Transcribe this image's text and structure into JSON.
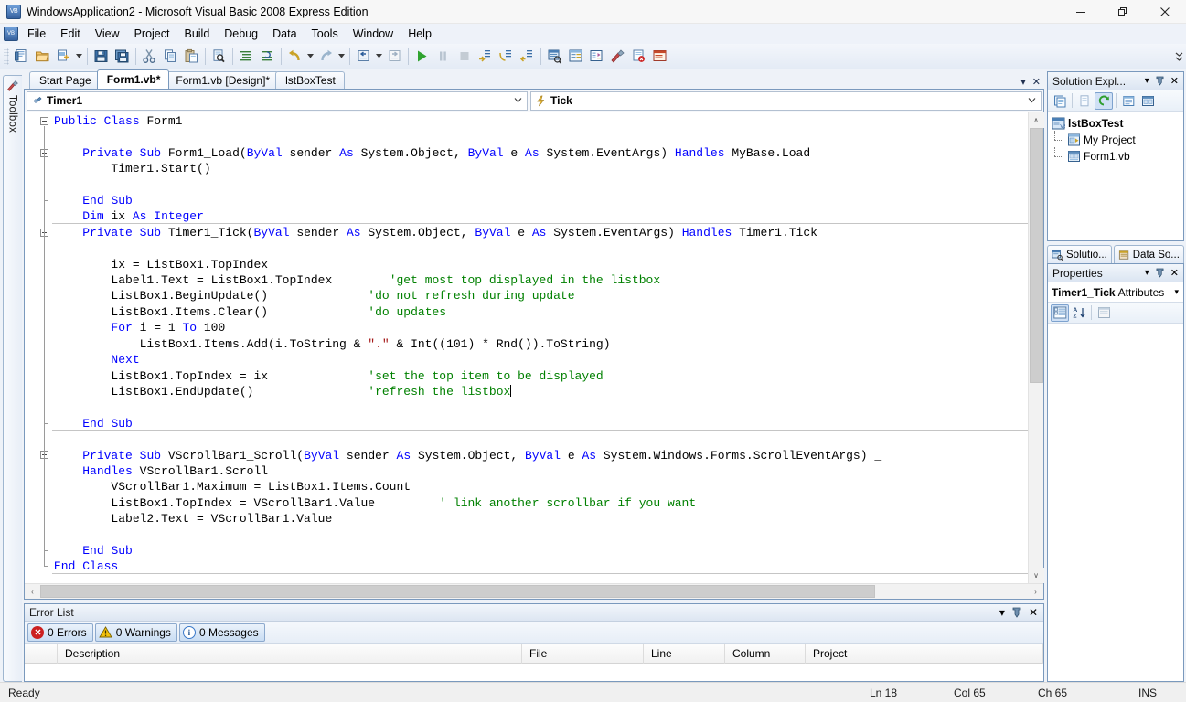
{
  "window": {
    "title": "WindowsApplication2 - Microsoft Visual Basic 2008 Express Edition",
    "app_icon": "visual-basic-icon",
    "minimize": "—",
    "maximize": "❐",
    "close": "✕"
  },
  "menu": {
    "items": [
      "File",
      "Edit",
      "View",
      "Project",
      "Build",
      "Debug",
      "Data",
      "Tools",
      "Window",
      "Help"
    ]
  },
  "toolbar": {
    "buttons": [
      {
        "name": "new-project-icon",
        "title": "New Project"
      },
      {
        "name": "open-file-icon",
        "title": "Open File"
      },
      {
        "name": "add-new-item-icon",
        "title": "Add New Item"
      },
      {
        "name": "save-icon",
        "title": "Save"
      },
      {
        "name": "save-all-icon",
        "title": "Save All"
      },
      {
        "name": "cut-icon",
        "title": "Cut"
      },
      {
        "name": "copy-icon",
        "title": "Copy"
      },
      {
        "name": "paste-icon",
        "title": "Paste"
      },
      {
        "name": "find-icon",
        "title": "Find"
      },
      {
        "name": "comment-icon",
        "title": "Comment"
      },
      {
        "name": "uncomment-icon",
        "title": "Uncomment"
      },
      {
        "name": "undo-icon",
        "title": "Undo"
      },
      {
        "name": "redo-icon",
        "title": "Redo"
      },
      {
        "name": "navigate-backward-icon",
        "title": "Navigate Backward"
      },
      {
        "name": "navigate-forward-icon",
        "title": "Navigate Forward"
      },
      {
        "name": "start-debugging-icon",
        "title": "Start Debugging"
      },
      {
        "name": "break-all-icon",
        "title": "Break All"
      },
      {
        "name": "stop-debugging-icon",
        "title": "Stop Debugging"
      },
      {
        "name": "step-into-icon",
        "title": "Step Into"
      },
      {
        "name": "step-over-icon",
        "title": "Step Over"
      },
      {
        "name": "step-out-icon",
        "title": "Step Out"
      },
      {
        "name": "solution-explorer-icon",
        "title": "Solution Explorer"
      },
      {
        "name": "properties-window-icon",
        "title": "Properties Window"
      },
      {
        "name": "object-browser-icon",
        "title": "Object Browser"
      },
      {
        "name": "toolbox-icon",
        "title": "Toolbox"
      },
      {
        "name": "error-list-icon",
        "title": "Error List"
      },
      {
        "name": "command-window-icon",
        "title": "Command Window"
      }
    ],
    "overflow_label": "»"
  },
  "toolbox_strip": {
    "label": "Toolbox",
    "icon": "toolbox-icon"
  },
  "document_tabs": [
    {
      "label": "Start Page",
      "active": false
    },
    {
      "label": "Form1.vb*",
      "active": true
    },
    {
      "label": "Form1.vb [Design]*",
      "active": false
    },
    {
      "label": "lstBoxTest",
      "active": false
    }
  ],
  "doc_tab_controls": {
    "dropdown": "▾",
    "close": "✕"
  },
  "editor": {
    "class_combo": {
      "value": "Timer1",
      "icon": "class-object-icon",
      "arrow": "⌄"
    },
    "member_combo": {
      "value": "Tick",
      "icon": "event-lightning-icon",
      "arrow": "⌄"
    },
    "code_lines": [
      {
        "n": 1,
        "indent": 0,
        "tokens": [
          [
            "kw",
            "Public"
          ],
          [
            "sp",
            " "
          ],
          [
            "kw",
            "Class"
          ],
          [
            "sp",
            " "
          ],
          [
            "id",
            "Form1"
          ]
        ]
      },
      {
        "n": 2,
        "indent": 0,
        "tokens": []
      },
      {
        "n": 3,
        "indent": 1,
        "tokens": [
          [
            "kw",
            "Private"
          ],
          [
            "sp",
            " "
          ],
          [
            "kw",
            "Sub"
          ],
          [
            "sp",
            " "
          ],
          [
            "id",
            "Form1_Load("
          ],
          [
            "kw",
            "ByVal"
          ],
          [
            "sp",
            " "
          ],
          [
            "id",
            "sender"
          ],
          [
            "sp",
            " "
          ],
          [
            "kw",
            "As"
          ],
          [
            "sp",
            " "
          ],
          [
            "id",
            "System.Object, "
          ],
          [
            "kw",
            "ByVal"
          ],
          [
            "sp",
            " "
          ],
          [
            "id",
            "e"
          ],
          [
            "sp",
            " "
          ],
          [
            "kw",
            "As"
          ],
          [
            "sp",
            " "
          ],
          [
            "id",
            "System.EventArgs) "
          ],
          [
            "kw",
            "Handles"
          ],
          [
            "sp",
            " "
          ],
          [
            "id",
            "MyBase.Load"
          ]
        ]
      },
      {
        "n": 4,
        "indent": 2,
        "tokens": [
          [
            "id",
            "Timer1.Start()"
          ]
        ]
      },
      {
        "n": 5,
        "indent": 0,
        "tokens": []
      },
      {
        "n": 6,
        "indent": 1,
        "tokens": [
          [
            "kw",
            "End"
          ],
          [
            "sp",
            " "
          ],
          [
            "kw",
            "Sub"
          ]
        ]
      },
      {
        "n": 7,
        "indent": 1,
        "tokens": [
          [
            "kw",
            "Dim"
          ],
          [
            "sp",
            " "
          ],
          [
            "id",
            "ix"
          ],
          [
            "sp",
            " "
          ],
          [
            "kw",
            "As"
          ],
          [
            "sp",
            " "
          ],
          [
            "kw",
            "Integer"
          ]
        ]
      },
      {
        "n": 8,
        "indent": 1,
        "tokens": [
          [
            "kw",
            "Private"
          ],
          [
            "sp",
            " "
          ],
          [
            "kw",
            "Sub"
          ],
          [
            "sp",
            " "
          ],
          [
            "id",
            "Timer1_Tick("
          ],
          [
            "kw",
            "ByVal"
          ],
          [
            "sp",
            " "
          ],
          [
            "id",
            "sender"
          ],
          [
            "sp",
            " "
          ],
          [
            "kw",
            "As"
          ],
          [
            "sp",
            " "
          ],
          [
            "id",
            "System.Object, "
          ],
          [
            "kw",
            "ByVal"
          ],
          [
            "sp",
            " "
          ],
          [
            "id",
            "e"
          ],
          [
            "sp",
            " "
          ],
          [
            "kw",
            "As"
          ],
          [
            "sp",
            " "
          ],
          [
            "id",
            "System.EventArgs) "
          ],
          [
            "kw",
            "Handles"
          ],
          [
            "sp",
            " "
          ],
          [
            "id",
            "Timer1.Tick"
          ]
        ]
      },
      {
        "n": 9,
        "indent": 0,
        "tokens": []
      },
      {
        "n": 10,
        "indent": 2,
        "tokens": [
          [
            "id",
            "ix = ListBox1.TopIndex"
          ]
        ]
      },
      {
        "n": 11,
        "indent": 2,
        "tokens": [
          [
            "id",
            "Label1.Text = ListBox1.TopIndex"
          ],
          [
            "pad",
            "        "
          ],
          [
            "cm",
            "'get most top displayed in the listbox"
          ]
        ]
      },
      {
        "n": 12,
        "indent": 2,
        "tokens": [
          [
            "id",
            "ListBox1.BeginUpdate()"
          ],
          [
            "pad",
            "              "
          ],
          [
            "cm",
            "'do not refresh during update"
          ]
        ]
      },
      {
        "n": 13,
        "indent": 2,
        "tokens": [
          [
            "id",
            "ListBox1.Items.Clear()"
          ],
          [
            "pad",
            "              "
          ],
          [
            "cm",
            "'do updates"
          ]
        ]
      },
      {
        "n": 14,
        "indent": 2,
        "tokens": [
          [
            "kw",
            "For"
          ],
          [
            "sp",
            " "
          ],
          [
            "id",
            "i = 1 "
          ],
          [
            "kw",
            "To"
          ],
          [
            "sp",
            " "
          ],
          [
            "id",
            "100"
          ]
        ]
      },
      {
        "n": 15,
        "indent": 3,
        "tokens": [
          [
            "id",
            "ListBox1.Items.Add(i.ToString & "
          ],
          [
            "st",
            "\".\""
          ],
          [
            "id",
            " & Int((101) * Rnd()).ToString)"
          ]
        ]
      },
      {
        "n": 16,
        "indent": 2,
        "tokens": [
          [
            "kw",
            "Next"
          ]
        ]
      },
      {
        "n": 17,
        "indent": 2,
        "tokens": [
          [
            "id",
            "ListBox1.TopIndex = ix"
          ],
          [
            "pad",
            "              "
          ],
          [
            "cm",
            "'set the top item to be displayed"
          ]
        ]
      },
      {
        "n": 18,
        "indent": 2,
        "tokens": [
          [
            "id",
            "ListBox1.EndUpdate()"
          ],
          [
            "pad",
            "                "
          ],
          [
            "cm",
            "'refresh the listbox"
          ],
          [
            "caret",
            ""
          ]
        ]
      },
      {
        "n": 19,
        "indent": 0,
        "tokens": []
      },
      {
        "n": 20,
        "indent": 1,
        "tokens": [
          [
            "kw",
            "End"
          ],
          [
            "sp",
            " "
          ],
          [
            "kw",
            "Sub"
          ]
        ]
      },
      {
        "n": 21,
        "indent": 0,
        "tokens": []
      },
      {
        "n": 22,
        "indent": 1,
        "tokens": [
          [
            "kw",
            "Private"
          ],
          [
            "sp",
            " "
          ],
          [
            "kw",
            "Sub"
          ],
          [
            "sp",
            " "
          ],
          [
            "id",
            "VScrollBar1_Scroll("
          ],
          [
            "kw",
            "ByVal"
          ],
          [
            "sp",
            " "
          ],
          [
            "id",
            "sender"
          ],
          [
            "sp",
            " "
          ],
          [
            "kw",
            "As"
          ],
          [
            "sp",
            " "
          ],
          [
            "id",
            "System.Object, "
          ],
          [
            "kw",
            "ByVal"
          ],
          [
            "sp",
            " "
          ],
          [
            "id",
            "e"
          ],
          [
            "sp",
            " "
          ],
          [
            "kw",
            "As"
          ],
          [
            "sp",
            " "
          ],
          [
            "id",
            "System.Windows.Forms.ScrollEventArgs) _"
          ]
        ]
      },
      {
        "n": 23,
        "indent": 1,
        "tokens": [
          [
            "kw",
            "Handles"
          ],
          [
            "sp",
            " "
          ],
          [
            "id",
            "VScrollBar1.Scroll"
          ]
        ]
      },
      {
        "n": 24,
        "indent": 2,
        "tokens": [
          [
            "id",
            "VScrollBar1.Maximum = ListBox1.Items.Count"
          ]
        ]
      },
      {
        "n": 25,
        "indent": 2,
        "tokens": [
          [
            "id",
            "ListBox1.TopIndex = VScrollBar1.Value"
          ],
          [
            "pad",
            "         "
          ],
          [
            "cm",
            "' link another scrollbar if you want"
          ]
        ]
      },
      {
        "n": 26,
        "indent": 2,
        "tokens": [
          [
            "id",
            "Label2.Text = VScrollBar1.Value"
          ]
        ]
      },
      {
        "n": 27,
        "indent": 0,
        "tokens": []
      },
      {
        "n": 28,
        "indent": 1,
        "tokens": [
          [
            "kw",
            "End"
          ],
          [
            "sp",
            " "
          ],
          [
            "kw",
            "Sub"
          ]
        ]
      },
      {
        "n": 29,
        "indent": 0,
        "tokens": [
          [
            "kw",
            "End"
          ],
          [
            "sp",
            " "
          ],
          [
            "kw",
            "Class"
          ]
        ]
      }
    ],
    "scroll_up": "∧",
    "scroll_down": "∨",
    "scroll_left": "‹",
    "scroll_right": "›"
  },
  "error_list": {
    "title": "Error List",
    "dropdown": "▾",
    "pin": "pin-icon",
    "close": "✕",
    "toggles": [
      {
        "label": "0 Errors",
        "icon": "error-icon",
        "color": "#cc2020"
      },
      {
        "label": "0 Warnings",
        "icon": "warning-icon",
        "color": "#f2c20c"
      },
      {
        "label": "0 Messages",
        "icon": "info-icon",
        "color": "#3a78c8"
      }
    ],
    "columns": [
      "Description",
      "File",
      "Line",
      "Column",
      "Project"
    ],
    "rows": []
  },
  "solution_explorer": {
    "title": "Solution Expl...",
    "dropdown": "▾",
    "pin": "pin-icon",
    "close": "✕",
    "tools": [
      {
        "name": "properties-icon"
      },
      {
        "name": "show-all-files-icon"
      },
      {
        "name": "refresh-icon"
      },
      {
        "name": "view-code-icon"
      },
      {
        "name": "view-designer-icon"
      }
    ],
    "tree": [
      {
        "label": "lstBoxTest",
        "icon": "project-icon",
        "level": 0,
        "bold": true
      },
      {
        "label": "My Project",
        "icon": "my-project-icon",
        "level": 1,
        "bold": false
      },
      {
        "label": "Form1.vb",
        "icon": "form-icon",
        "level": 1,
        "bold": false
      }
    ]
  },
  "dock_tabs": [
    {
      "label": "Solutio...",
      "icon": "solution-explorer-icon",
      "active": true
    },
    {
      "label": "Data So...",
      "icon": "data-sources-icon",
      "active": false
    }
  ],
  "properties": {
    "title": "Properties",
    "dropdown": "▾",
    "pin": "pin-icon",
    "close": "✕",
    "object_name": "Timer1_Tick",
    "object_kind": "Attributes",
    "object_arrow": "▾",
    "tools": [
      {
        "name": "categorized-icon",
        "active": true
      },
      {
        "name": "alphabetical-icon",
        "active": false
      },
      {
        "name": "properties-page-icon",
        "active": false
      }
    ]
  },
  "status_bar": {
    "state": "Ready",
    "line": "Ln 18",
    "col": "Col 65",
    "ch": "Ch 65",
    "mode": "INS"
  },
  "colors": {
    "keyword": "#0000ff",
    "comment": "#008000",
    "string": "#a31515",
    "chrome": "#eef2f8",
    "panel_border": "#7a99bd",
    "accent": "#cfe0f5"
  }
}
